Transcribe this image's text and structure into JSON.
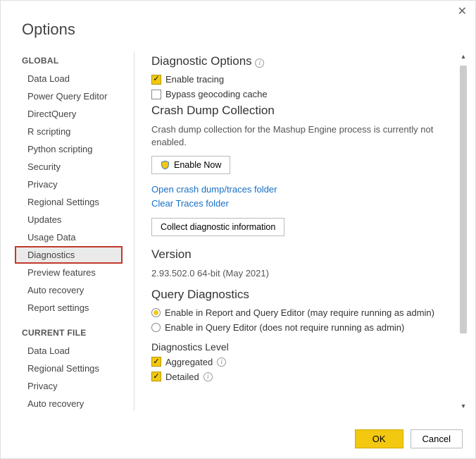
{
  "window": {
    "title": "Options"
  },
  "sidebar": {
    "global_header": "GLOBAL",
    "current_header": "CURRENT FILE",
    "global_items": [
      "Data Load",
      "Power Query Editor",
      "DirectQuery",
      "R scripting",
      "Python scripting",
      "Security",
      "Privacy",
      "Regional Settings",
      "Updates",
      "Usage Data",
      "Diagnostics",
      "Preview features",
      "Auto recovery",
      "Report settings"
    ],
    "current_items": [
      "Data Load",
      "Regional Settings",
      "Privacy",
      "Auto recovery"
    ],
    "selected": "Diagnostics"
  },
  "diag": {
    "options_hdr": "Diagnostic Options",
    "enable_tracing": "Enable tracing",
    "bypass_geo": "Bypass geocoding cache",
    "crash_hdr": "Crash Dump Collection",
    "crash_desc": "Crash dump collection for the Mashup Engine process is currently not enabled.",
    "enable_now": "Enable Now",
    "open_folder": "Open crash dump/traces folder",
    "clear_traces": "Clear Traces folder",
    "collect_btn": "Collect diagnostic information",
    "version_hdr": "Version",
    "version_val": "2.93.502.0 64-bit (May 2021)",
    "query_hdr": "Query Diagnostics",
    "radio1": "Enable in Report and Query Editor (may require running as admin)",
    "radio2": "Enable in Query Editor (does not require running as admin)",
    "level_hdr": "Diagnostics Level",
    "aggregated": "Aggregated",
    "detailed": "Detailed"
  },
  "footer": {
    "ok": "OK",
    "cancel": "Cancel"
  }
}
